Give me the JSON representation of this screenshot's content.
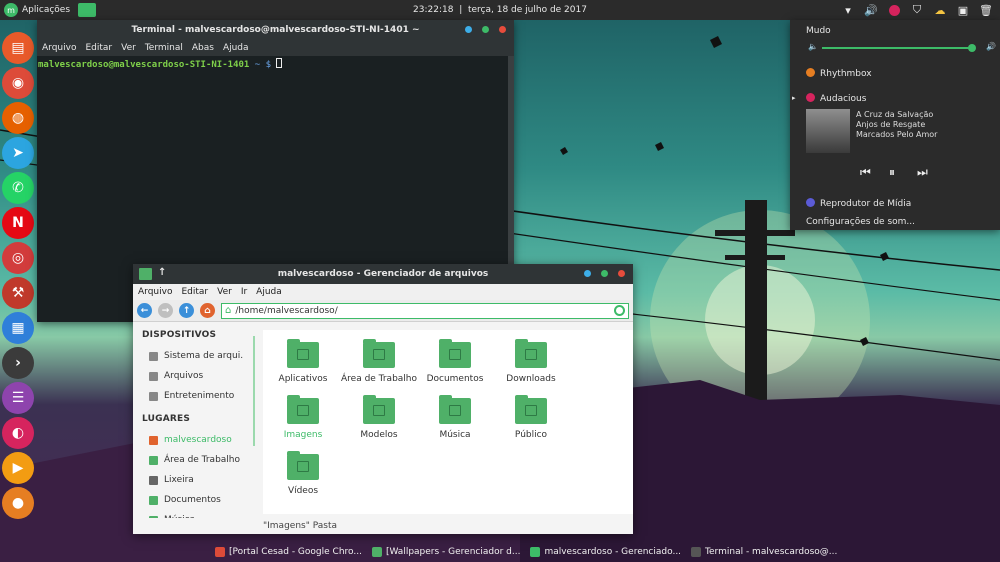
{
  "top_panel": {
    "apps_label": "Aplicações",
    "clock": "23:22:18",
    "separator": "|",
    "date": "terça, 18 de julho de 2017",
    "tray_icons": [
      "wifi-icon",
      "volume-icon",
      "audacious-icon",
      "shield-icon",
      "weather-icon",
      "clipboard-icon",
      "trash-icon"
    ]
  },
  "dock": {
    "apps": [
      {
        "name": "folder-app",
        "color": "#e85a2a"
      },
      {
        "name": "chrome",
        "color": "#dd4b39"
      },
      {
        "name": "firefox",
        "color": "#e66000"
      },
      {
        "name": "telegram",
        "color": "#2ca5e0"
      },
      {
        "name": "whatsapp",
        "color": "#25d366"
      },
      {
        "name": "netflix",
        "color": "#e50914"
      },
      {
        "name": "photo",
        "color": "#d23c3c"
      },
      {
        "name": "toolbox",
        "color": "#c0392b"
      },
      {
        "name": "package",
        "color": "#2f7fd9"
      },
      {
        "name": "terminal",
        "color": "#3b3b3b"
      },
      {
        "name": "text-editor",
        "color": "#8e44ad"
      },
      {
        "name": "audacious",
        "color": "#d6245e"
      },
      {
        "name": "media-player",
        "color": "#f39c12"
      },
      {
        "name": "user",
        "color": "#e67e22"
      }
    ]
  },
  "terminal": {
    "title": "Terminal - malvescardoso@malvescardoso-STI-NI-1401 ~",
    "menu": [
      "Arquivo",
      "Editar",
      "Ver",
      "Terminal",
      "Abas",
      "Ajuda"
    ],
    "prompt_user": "malvescardoso@malvescardoso-STI-NI-1401",
    "prompt_dir": "~ $"
  },
  "file_manager": {
    "title": "malvescardoso - Gerenciador de arquivos",
    "menu": [
      "Arquivo",
      "Editar",
      "Ver",
      "Ir",
      "Ajuda"
    ],
    "location": "/home/malvescardoso/",
    "devices_header": "DISPOSITIVOS",
    "devices": [
      "Sistema de arqui...",
      "Arquivos",
      "Entretenimento"
    ],
    "places_header": "LUGARES",
    "places": [
      "malvescardoso",
      "Área de Trabalho",
      "Lixeira",
      "Documentos",
      "Música"
    ],
    "active_place": "malvescardoso",
    "items": [
      "Aplicativos",
      "Área de Trabalho",
      "Documentos",
      "Downloads",
      "Imagens",
      "Modelos",
      "Música",
      "Público",
      "Vídeos"
    ],
    "selected_item": "Imagens",
    "status": "\"Imagens\" Pasta"
  },
  "sound_popup": {
    "mute_label": "Mudo",
    "volume_fraction": 0.96,
    "rhythmbox": "Rhythmbox",
    "audacious": "Audacious",
    "track_title": "A Cruz da Salvação",
    "track_artist": "Anjos de Resgate",
    "track_album": "Marcados Pelo Amor",
    "media_player": "Reprodutor de Mídia",
    "settings": "Configurações de som..."
  },
  "taskbar": {
    "tasks": [
      {
        "label": "[Portal Cesad - Google Chro...",
        "color": "#dd4b39"
      },
      {
        "label": "[Wallpapers - Gerenciador d...",
        "color": "#4fb068"
      },
      {
        "label": "malvescardoso - Gerenciado...",
        "color": "#3dbb68"
      },
      {
        "label": "Terminal - malvescardoso@...",
        "color": "#555555"
      }
    ]
  }
}
